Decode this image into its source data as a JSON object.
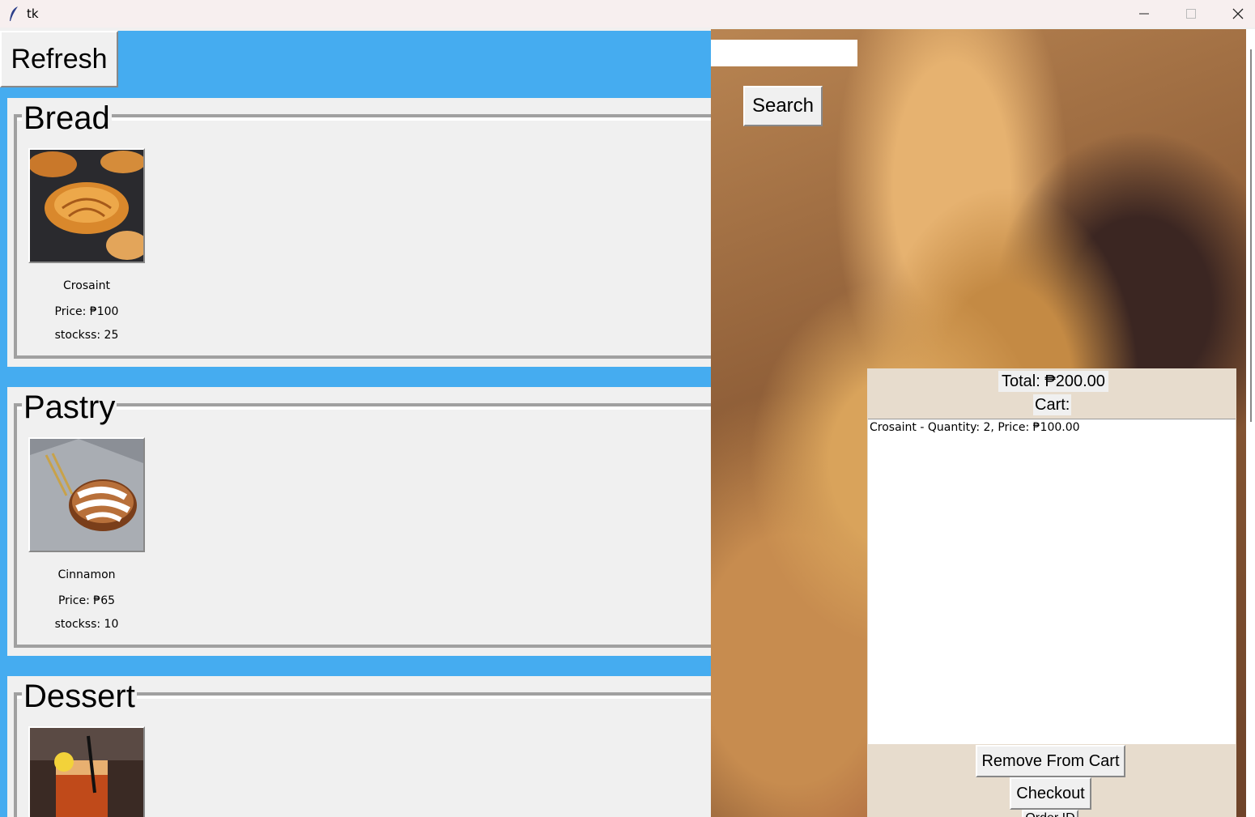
{
  "window": {
    "title": "tk",
    "icon": "feather-icon",
    "controls": [
      "minimize-icon",
      "maximize-icon",
      "close-icon"
    ]
  },
  "toolbar": {
    "refresh_label": "Refresh"
  },
  "categories": [
    {
      "title": "Bread",
      "product": {
        "name": "Crosaint",
        "price": "Price: ₱100",
        "stock": "stockss: 25",
        "image": "croissant-photo"
      }
    },
    {
      "title": "Pastry",
      "product": {
        "name": "Cinnamon",
        "price": "Price: ₱65",
        "stock": "stockss: 10",
        "image": "cinnamon-roll-photo"
      }
    },
    {
      "title": "Dessert",
      "product": {
        "image": "iced-tea-photo"
      }
    }
  ],
  "search": {
    "value": "",
    "button_label": "Search"
  },
  "cart": {
    "total": "Total: ₱200.00",
    "label": "Cart:",
    "items": [
      "Crosaint - Quantity: 2, Price: ₱100.00"
    ],
    "remove_label": "Remove From Cart",
    "checkout_label": "Checkout",
    "order_id_label": "Order ID"
  },
  "colors": {
    "left_background": "#45acf0",
    "panel": "#f0f0f0",
    "cart_panel": "#e7dccd"
  }
}
